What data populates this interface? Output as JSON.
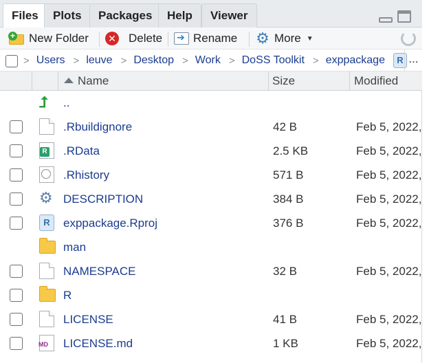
{
  "tabs": [
    {
      "label": "Files",
      "active": true
    },
    {
      "label": "Plots"
    },
    {
      "label": "Packages"
    },
    {
      "label": "Help"
    },
    {
      "label": "Viewer"
    }
  ],
  "toolbar": {
    "new_folder": "New Folder",
    "delete": "Delete",
    "rename": "Rename",
    "more": "More"
  },
  "breadcrumb": [
    "Users",
    "leuve",
    "Desktop",
    "Work",
    "DoSS Toolkit",
    "exppackage"
  ],
  "breadcrumb_more": "...",
  "columns": {
    "name": "Name",
    "size": "Size",
    "modified": "Modified"
  },
  "parent_dir": "..",
  "files": [
    {
      "name": ".Rbuildignore",
      "size": "42 B",
      "modified": "Feb 5, 2022,",
      "icon": "file-icon"
    },
    {
      "name": ".RData",
      "size": "2.5 KB",
      "modified": "Feb 5, 2022,",
      "icon": "rdata-icon"
    },
    {
      "name": ".Rhistory",
      "size": "571 B",
      "modified": "Feb 5, 2022,",
      "icon": "history-icon"
    },
    {
      "name": "DESCRIPTION",
      "size": "384 B",
      "modified": "Feb 5, 2022,",
      "icon": "gear-icon"
    },
    {
      "name": "exppackage.Rproj",
      "size": "376 B",
      "modified": "Feb 5, 2022,",
      "icon": "rproj-icon"
    },
    {
      "name": "man",
      "size": "",
      "modified": "",
      "icon": "folder-icon"
    },
    {
      "name": "NAMESPACE",
      "size": "32 B",
      "modified": "Feb 5, 2022,",
      "icon": "file-icon"
    },
    {
      "name": "R",
      "size": "",
      "modified": "",
      "icon": "folder-icon"
    },
    {
      "name": "LICENSE",
      "size": "41 B",
      "modified": "Feb 5, 2022,",
      "icon": "file-icon"
    },
    {
      "name": "LICENSE.md",
      "size": "1 KB",
      "modified": "Feb 5, 2022,",
      "icon": "markdown-icon"
    }
  ],
  "colors": {
    "link": "#1b3c8f",
    "folder": "#f7c948",
    "up_arrow": "#2e9e3a"
  }
}
